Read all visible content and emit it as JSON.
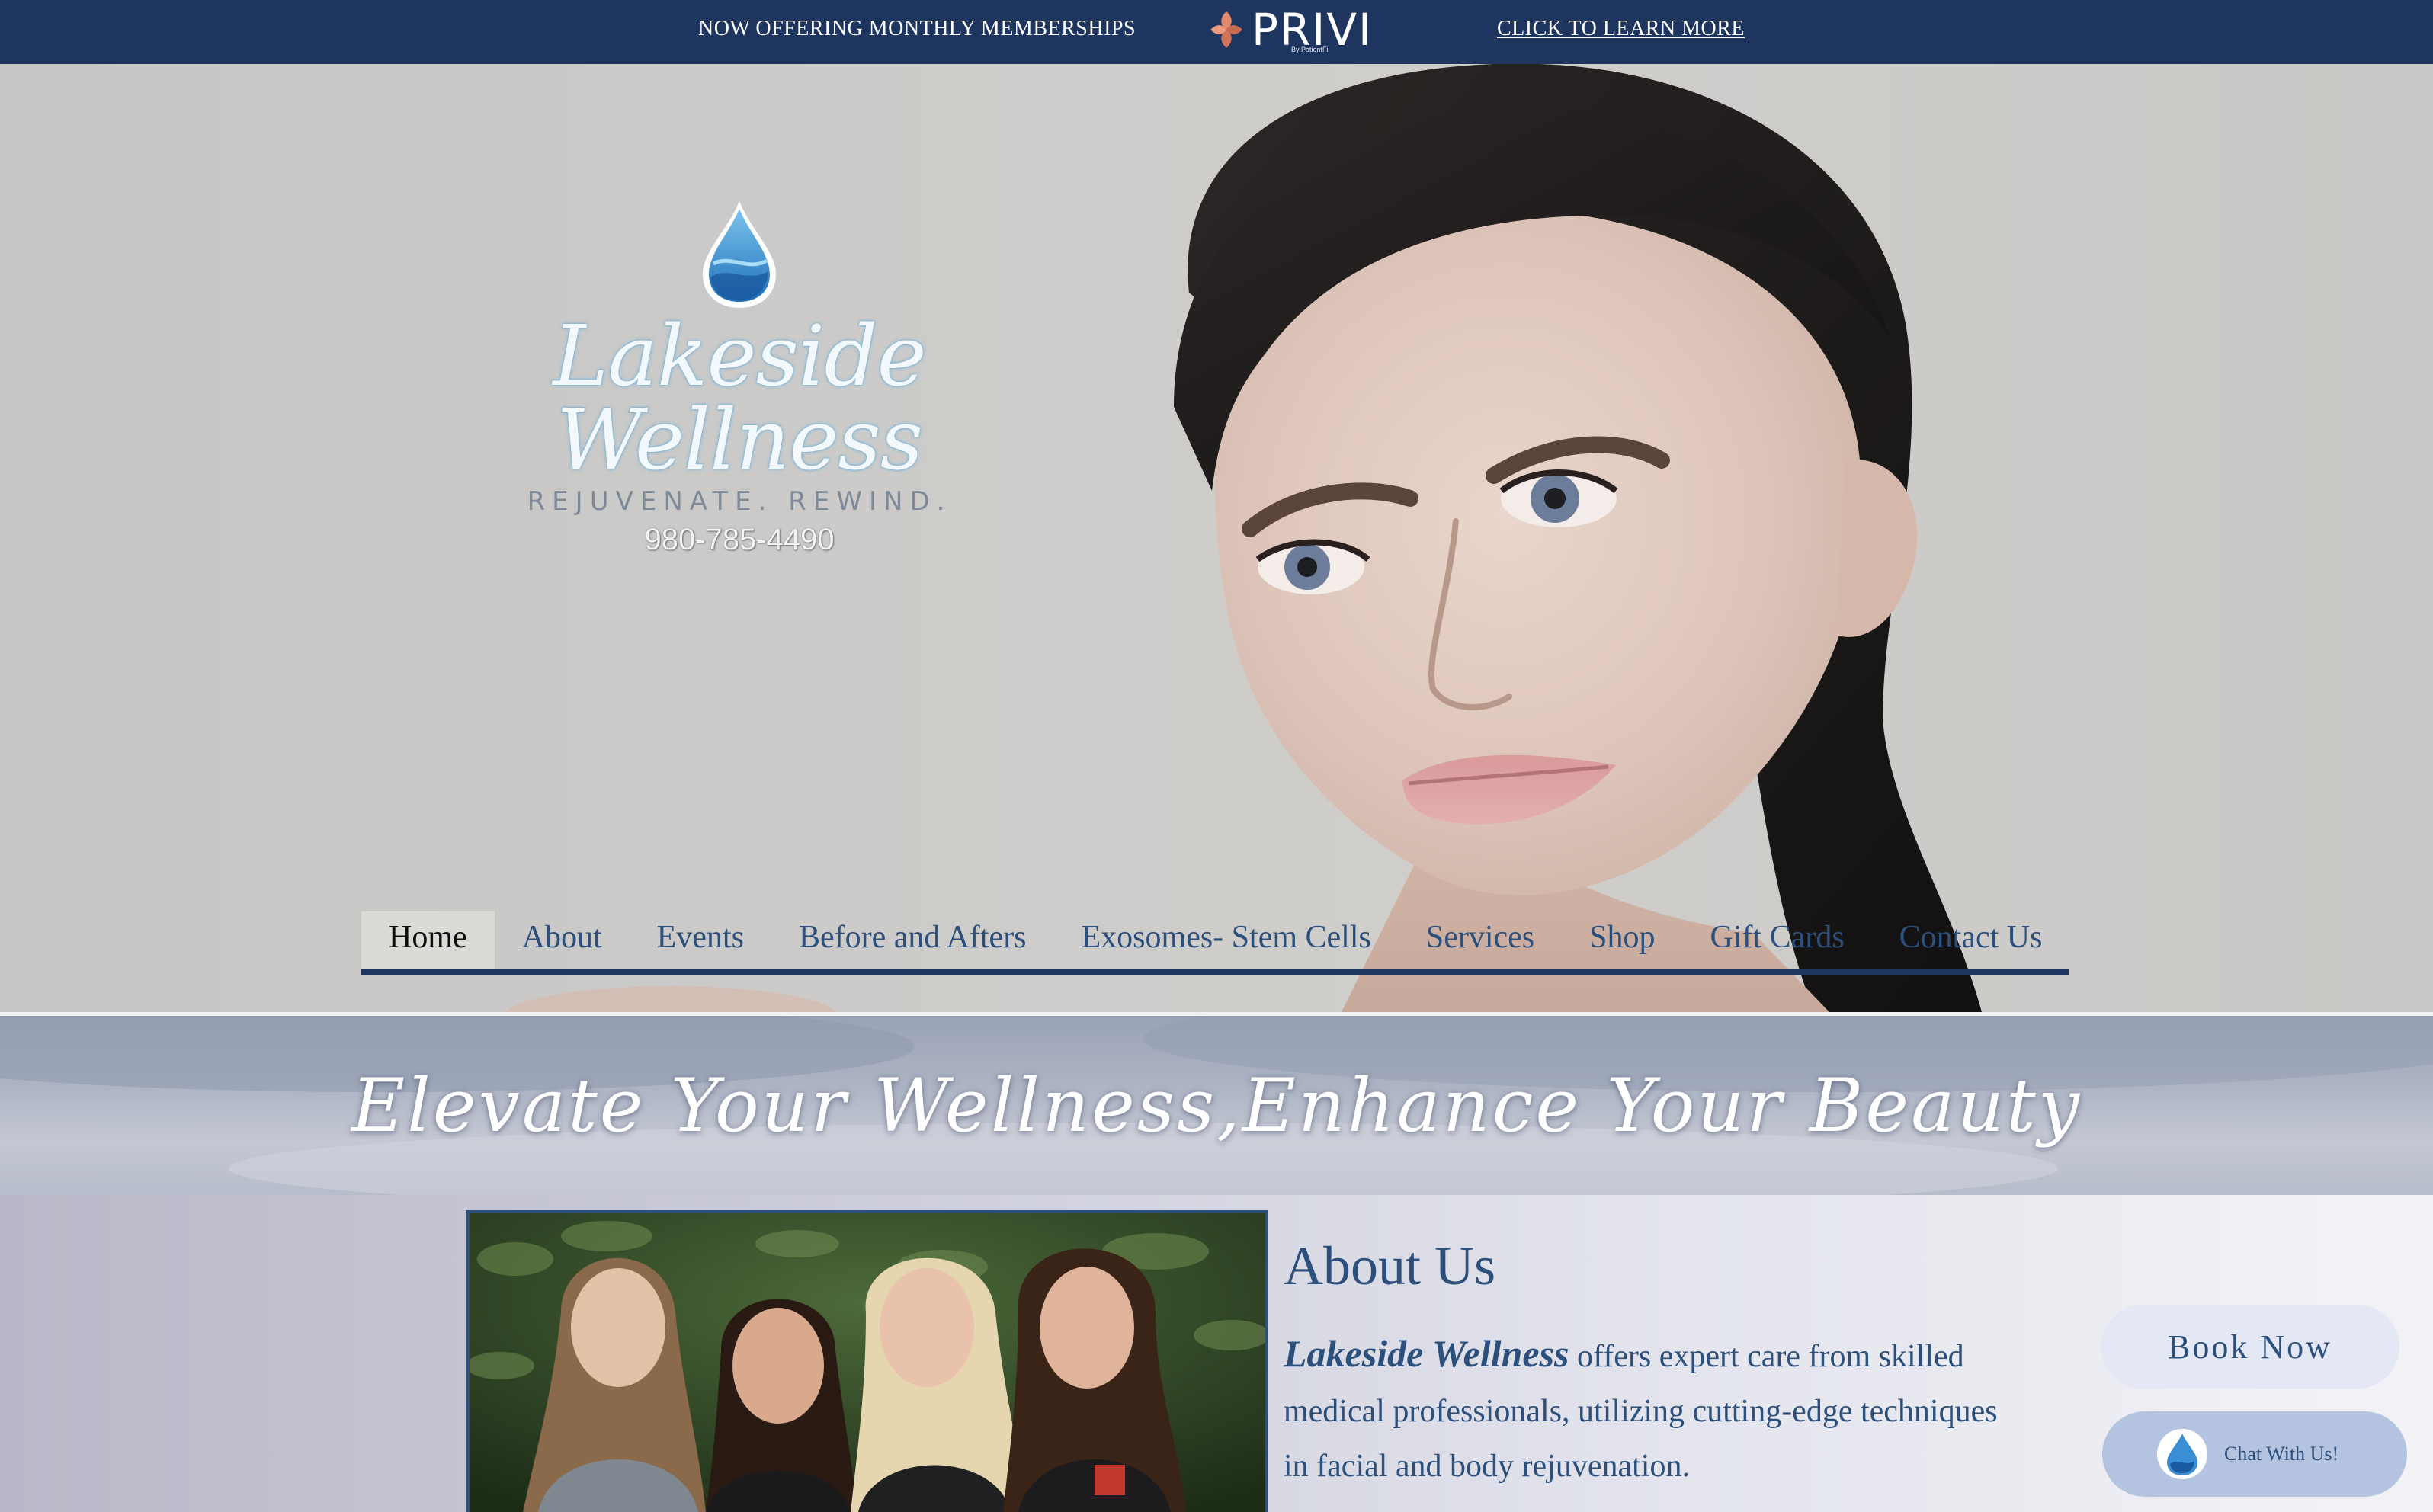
{
  "promo": {
    "text": "NOW OFFERING MONTHLY MEMBERSHIPS",
    "brand": "PRIVI",
    "brand_sub": "By PatientFi",
    "link": "CLICK TO LEARN MORE",
    "bg_color": "#1e3560"
  },
  "logo": {
    "name": "Lakeside Wellness",
    "tagline": "REJUVENATE. REWIND.",
    "phone": "980-785-4490",
    "icon": "water-drop-icon"
  },
  "nav": {
    "items": [
      {
        "label": "Home",
        "active": true
      },
      {
        "label": "About"
      },
      {
        "label": "Events"
      },
      {
        "label": "Before and Afters"
      },
      {
        "label": "Exosomes- Stem Cells"
      },
      {
        "label": "Services"
      },
      {
        "label": "Shop"
      },
      {
        "label": "Gift Cards"
      },
      {
        "label": "Contact Us"
      }
    ]
  },
  "banner": {
    "title": "Elevate Your Wellness,Enhance Your Beauty"
  },
  "about": {
    "title": "About Us",
    "brand": "Lakeside Wellness",
    "body": " offers expert care from skilled medical professionals, utilizing cutting-edge techniques in facial and body rejuvenation."
  },
  "actions": {
    "book": "Book Now",
    "chat": "Chat With Us!"
  },
  "colors": {
    "accent": "#2c4f7c",
    "navy": "#1e3560",
    "drop": "#3a8fd4"
  }
}
